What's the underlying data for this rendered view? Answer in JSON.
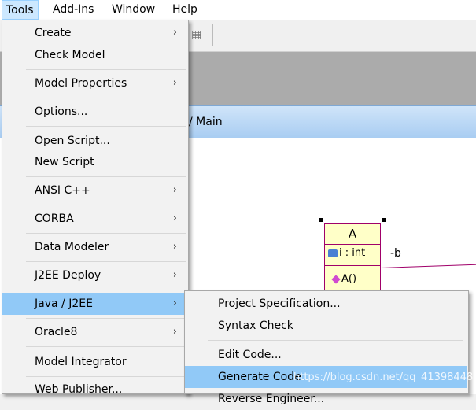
{
  "menubar": {
    "items": [
      {
        "label": "Tools"
      },
      {
        "label": "Add-Ins"
      },
      {
        "label": "Window"
      },
      {
        "label": "Help"
      }
    ]
  },
  "document": {
    "title": "/ Main"
  },
  "uml_class": {
    "name": "A",
    "attribute": "i : int",
    "operation": "A()",
    "role_label": "-b"
  },
  "tools_menu": {
    "items": [
      {
        "label": "Create"
      },
      {
        "label": "Check Model"
      },
      {
        "label": "Model Properties"
      },
      {
        "label": "Options..."
      },
      {
        "label": "Open Script..."
      },
      {
        "label": "New Script"
      },
      {
        "label": "ANSI C++"
      },
      {
        "label": "CORBA"
      },
      {
        "label": "Data Modeler"
      },
      {
        "label": "J2EE Deploy"
      },
      {
        "label": "Java / J2EE"
      },
      {
        "label": "Oracle8"
      },
      {
        "label": "Model Integrator"
      },
      {
        "label": "Web Publisher..."
      }
    ],
    "arrow_glyph": "›"
  },
  "java_submenu": {
    "items": [
      {
        "label": "Project Specification..."
      },
      {
        "label": "Syntax Check"
      },
      {
        "label": "Edit Code..."
      },
      {
        "label": "Generate Code"
      },
      {
        "label": "Reverse Engineer..."
      }
    ]
  },
  "watermark": "https://blog.csdn.net/qq_41398448",
  "colors": {
    "menu_highlight": "#91c9f7",
    "menubar_active": "#cce8ff",
    "uml_fill": "#ffffc8",
    "uml_border": "#a0006a"
  }
}
